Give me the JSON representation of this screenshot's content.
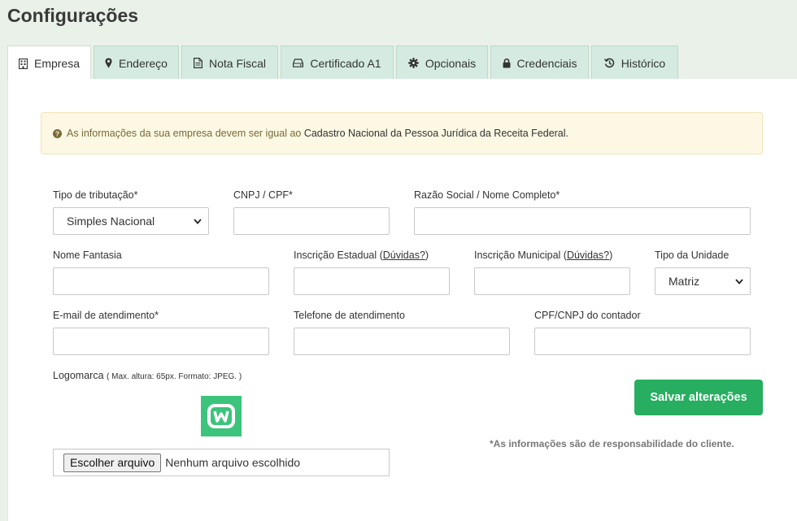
{
  "page": {
    "title": "Configurações"
  },
  "tabs": [
    {
      "label": "Empresa",
      "icon": "building-icon",
      "active": true
    },
    {
      "label": "Endereço",
      "icon": "map-marker-icon"
    },
    {
      "label": "Nota Fiscal",
      "icon": "document-icon"
    },
    {
      "label": "Certificado A1",
      "icon": "drive-icon"
    },
    {
      "label": "Opcionais",
      "icon": "gear-icon"
    },
    {
      "label": "Credenciais",
      "icon": "lock-icon"
    },
    {
      "label": "Histórico",
      "icon": "history-icon"
    }
  ],
  "alert": {
    "icon": "question-circle-icon",
    "prefix": "As informações da sua empresa devem ser igual ao ",
    "emphasis": "Cadastro Nacional da Pessoa Jurídica da Receita Federal."
  },
  "form": {
    "tipo_tributacao": {
      "label": "Tipo de tributação*",
      "value": "Simples Nacional"
    },
    "cnpj": {
      "label": "CNPJ / CPF*",
      "value": ""
    },
    "razao_social": {
      "label": "Razão Social / Nome Completo*",
      "value": ""
    },
    "nome_fantasia": {
      "label": "Nome Fantasia",
      "value": ""
    },
    "inscricao_estadual": {
      "label": "Inscrição Estadual (",
      "link": "Dúvidas?",
      "suffix": ")",
      "value": ""
    },
    "inscricao_municipal": {
      "label": "Inscrição Municipal (",
      "link": "Dúvidas?",
      "suffix": ")",
      "value": ""
    },
    "tipo_unidade": {
      "label": "Tipo da Unidade",
      "value": "Matriz"
    },
    "email": {
      "label": "E-mail de atendimento*",
      "value": ""
    },
    "telefone": {
      "label": "Telefone de atendimento",
      "value": ""
    },
    "contador": {
      "label": "CPF/CNPJ do contador",
      "value": ""
    },
    "logomarca": {
      "label": "Logomarca",
      "hint": "( Max. altura: 65px. Formato: JPEG. )",
      "file_button": "Escolher arquivo",
      "file_status": "Nenhum arquivo escolhido"
    }
  },
  "actions": {
    "save_label": "Salvar alterações"
  },
  "footer_note": "*As informações são de responsabilidade do cliente.",
  "colors": {
    "accent": "#27ae60",
    "tab_bg": "#d5ebe1",
    "alert_bg": "#fcf8e3",
    "logo_bg": "#3cc47c"
  }
}
